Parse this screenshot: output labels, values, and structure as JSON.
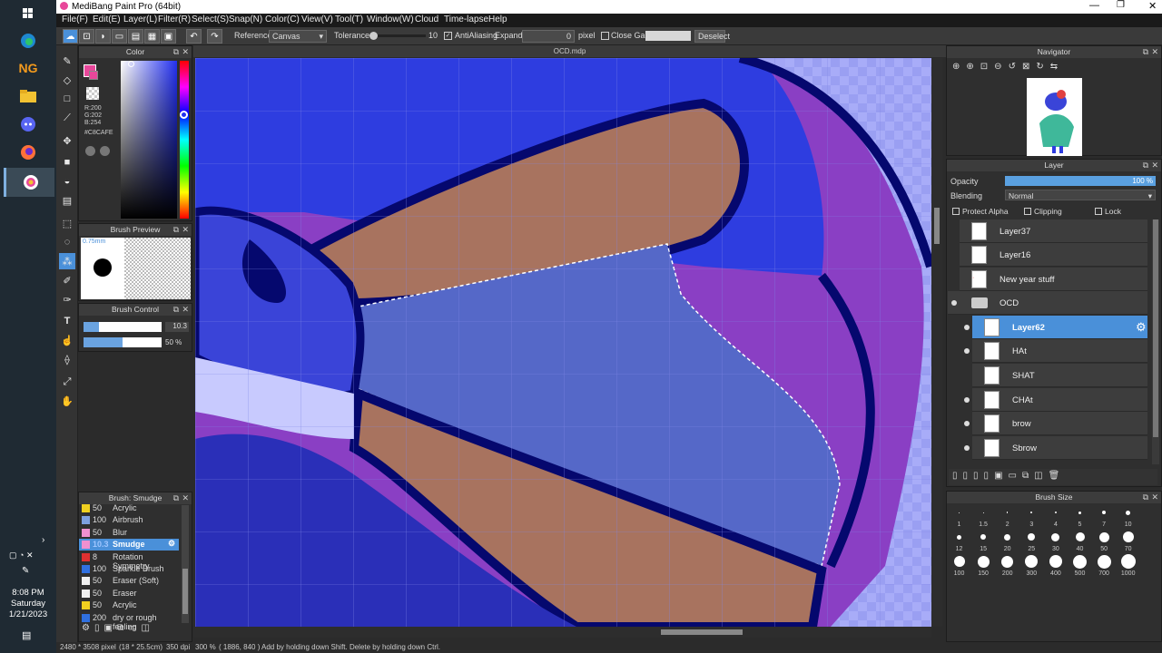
{
  "taskbar": {
    "icons": [
      "windows-start-icon",
      "edge-icon",
      "newgrounds-icon",
      "file-explorer-icon",
      "discord-icon",
      "firefox-icon",
      "medibang-icon"
    ],
    "ng_label": "NG",
    "time": "8:08 PM",
    "day": "Saturday",
    "date": "1/21/2023"
  },
  "titlebar": {
    "title": "MediBang Paint Pro (64bit)"
  },
  "menu": [
    "File(F)",
    "Edit(E)",
    "Layer(L)",
    "Filter(R)",
    "Select(S)",
    "Snap(N)",
    "Color(C)",
    "View(V)",
    "Tool(T)",
    "Window(W)",
    "Cloud",
    "Time-lapse",
    "Help"
  ],
  "toolbar": {
    "reference_label": "Reference",
    "reference_value": "Canvas",
    "tolerance_label": "Tolerance",
    "tolerance_value": "10",
    "antialiasing_label": "AntiAliasing",
    "expand_label": "Expand",
    "expand_value": "0",
    "expand_unit": "pixel",
    "close_gaps_label": "Close Gaps",
    "deselect_label": "Deselect"
  },
  "color_panel": {
    "title": "Color",
    "r": "R:200",
    "g": "G:202",
    "b": "B:254",
    "hex": "#C8CAFE",
    "fg_color": "#e8479a",
    "picked_color": "#C8CAFE"
  },
  "brush_preview": {
    "title": "Brush Preview",
    "size": "0.75mm"
  },
  "brush_control": {
    "title": "Brush Control",
    "size_value": "10.3",
    "opacity_value": "50 %",
    "size_fraction": 0.2,
    "opacity_fraction": 0.5
  },
  "brush_list": {
    "title": "Brush: Smudge",
    "items": [
      {
        "size": "50",
        "name": "Acrylic",
        "color": "#f0d020"
      },
      {
        "size": "100",
        "name": "Airbrush",
        "color": "#7da0e0"
      },
      {
        "size": "50",
        "name": "Blur",
        "color": "#f090d0"
      },
      {
        "size": "10.3",
        "name": "Smudge",
        "color": "#f090d0"
      },
      {
        "size": "8",
        "name": "Rotation Symmetry",
        "color": "#e03030"
      },
      {
        "size": "100",
        "name": "Sparkle Brush",
        "color": "#3070e0"
      },
      {
        "size": "50",
        "name": "Eraser (Soft)",
        "color": "#f0f0f0"
      },
      {
        "size": "50",
        "name": "Eraser",
        "color": "#f0f0f0"
      },
      {
        "size": "50",
        "name": "Acrylic",
        "color": "#f0d020"
      },
      {
        "size": "200",
        "name": "dry or rough feeling",
        "color": "#3070e0"
      }
    ]
  },
  "document": {
    "tab_title": "OCD.mdp"
  },
  "navigator": {
    "title": "Navigator"
  },
  "layer_panel": {
    "title": "Layer",
    "opacity_label": "Opacity",
    "opacity_value": "100 %",
    "opacity_fraction": 1.0,
    "blending_label": "Blending",
    "blending_value": "Normal",
    "protect_alpha_label": "Protect Alpha",
    "clipping_label": "Clipping",
    "lock_label": "Lock",
    "layers": [
      {
        "name": "Layer37"
      },
      {
        "name": "Layer16"
      },
      {
        "name": "New year stuff"
      },
      {
        "name": "OCD"
      },
      {
        "name": "Layer62"
      },
      {
        "name": "HAt"
      },
      {
        "name": "SHAT"
      },
      {
        "name": "CHAt"
      },
      {
        "name": "brow"
      },
      {
        "name": "Sbrow"
      }
    ]
  },
  "brush_size_panel": {
    "title": "Brush Size",
    "sizes": [
      "1",
      "1.5",
      "2",
      "3",
      "4",
      "5",
      "7",
      "10",
      "12",
      "15",
      "20",
      "25",
      "30",
      "40",
      "50",
      "70",
      "100",
      "150",
      "200",
      "300",
      "400",
      "500",
      "700",
      "1000"
    ]
  },
  "status": {
    "dimensions": "2480 * 3508 pixel",
    "physical": "(18 * 25.5cm)",
    "dpi": "350 dpi",
    "zoom": "300 %",
    "cursor": "( 1886, 840 )",
    "hint": "Add by holding down Shift. Delete by holding down Ctrl."
  }
}
